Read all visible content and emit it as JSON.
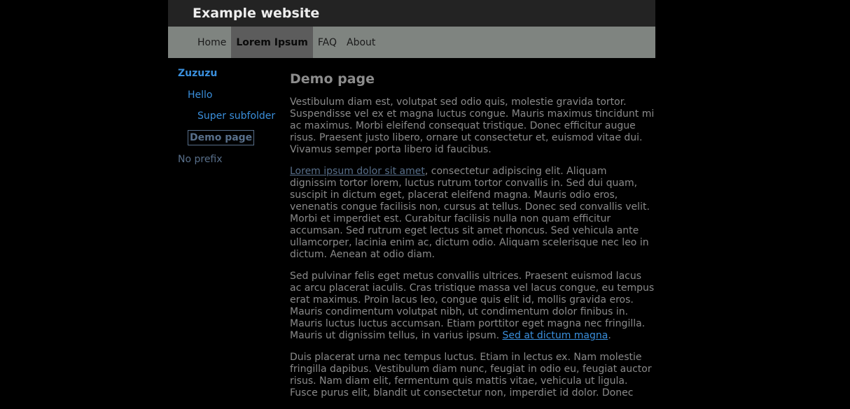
{
  "header": {
    "title": "Example website"
  },
  "nav": {
    "items": [
      {
        "label": "Home"
      },
      {
        "label": "Lorem Ipsum"
      },
      {
        "label": "FAQ"
      },
      {
        "label": "About"
      }
    ]
  },
  "sidebar": {
    "items": [
      {
        "label": "Zuzuzu"
      },
      {
        "label": "Hello"
      },
      {
        "label": "Super subfolder"
      },
      {
        "label": "Demo page"
      },
      {
        "label": "No prefix"
      }
    ]
  },
  "main": {
    "title": "Demo page",
    "p1": "Vestibulum diam est, volutpat sed odio quis, molestie gravida tortor. Suspendisse vel ex et magna luctus congue. Mauris maximus tincidunt mi ac maximus. Morbi eleifend consequat tristique. Donec efficitur augue risus. Praesent justo libero, ornare ut consectetur et, euismod vitae dui. Vivamus semper porta libero id faucibus.",
    "p2_link": "Lorem ipsum dolor sit amet",
    "p2_rest": ", consectetur adipiscing elit. Aliquam dignissim tortor lorem, luctus rutrum tortor convallis in. Sed dui quam, suscipit in dictum eget, placerat eleifend magna. Mauris odio eros, venenatis congue facilisis non, cursus at tellus. Donec sed convallis velit. Morbi et imperdiet est. Curabitur facilisis nulla non quam efficitur accumsan. Sed rutrum eget lectus sit amet rhoncus. Sed vehicula ante ullamcorper, lacinia enim ac, dictum odio. Aliquam scelerisque nec leo in dictum. Aenean at odio diam.",
    "p3_text": "Sed pulvinar felis eget metus convallis ultrices. Praesent euismod lacus ac arcu placerat iaculis. Cras tristique massa vel lacus congue, eu tempus erat maximus. Proin lacus leo, congue quis elit id, mollis gravida eros. Mauris condimentum volutpat nibh, ut condimentum dolor finibus in. Mauris luctus luctus accumsan. Etiam porttitor eget magna nec fringilla. Mauris ut dignissim tellus, in varius ipsum. ",
    "p3_link": "Sed at dictum magna",
    "p3_end": ".",
    "p4": "Duis placerat urna nec tempus luctus. Etiam in lectus ex. Nam molestie fringilla dapibus. Vestibulum diam nunc, feugiat in odio eu, feugiat auctor risus. Nam diam elit, fermentum quis mattis vitae, vehicula ut ligula. Fusce purus elit, blandit ut consectetur non, imperdiet id dolor. Donec"
  },
  "colors": {
    "background": "#000000",
    "header_bg": "#232323",
    "nav_bg": "#7f8480",
    "nav_active_bg": "#5c5c5c",
    "link": "#3a8fdc",
    "link_visited": "#586f8a",
    "text": "#8a8a8a"
  }
}
